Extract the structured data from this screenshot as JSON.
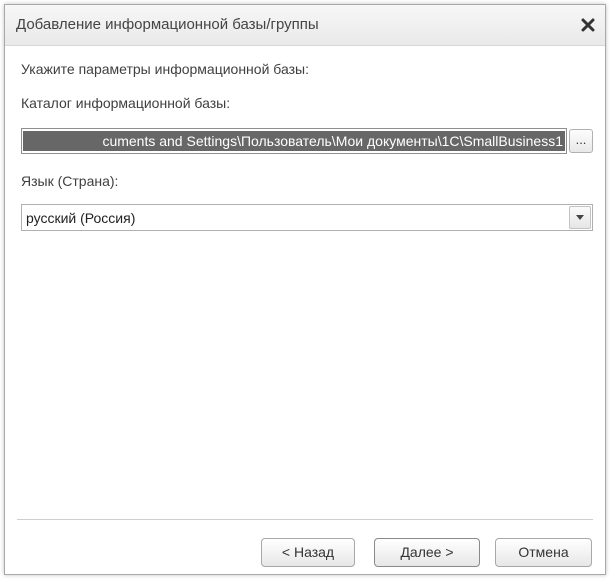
{
  "window": {
    "title": "Добавление информационной базы/группы",
    "close_icon": "close-icon"
  },
  "form": {
    "intro_label": "Укажите параметры информационной базы:",
    "catalog_label": "Каталог информационной базы:",
    "catalog_value": "cuments and Settings\\Пользователь\\Мои документы\\1C\\SmallBusiness1",
    "browse_label": "...",
    "language_label": "Язык (Страна):",
    "language_value": "русский (Россия)",
    "dropdown_icon": "chevron-down-icon"
  },
  "buttons": {
    "back": "< Назад",
    "next": "Далее >",
    "cancel": "Отмена"
  },
  "colors": {
    "selection": "#676767",
    "titlebar": "#eeeeee"
  }
}
